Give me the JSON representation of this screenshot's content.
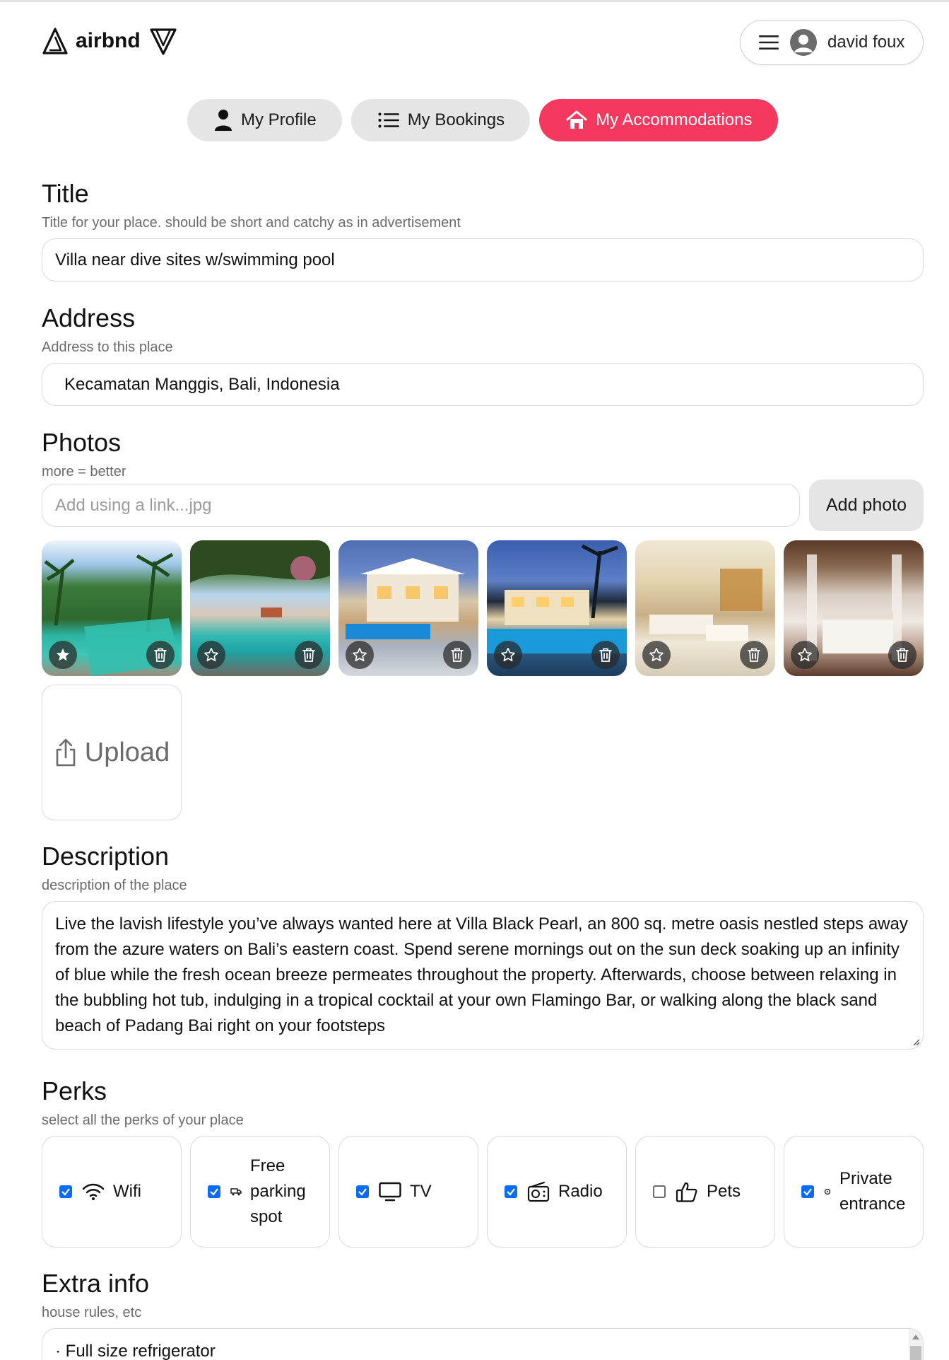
{
  "app": {
    "brand": "airbnd",
    "user_name": "david foux"
  },
  "nav": {
    "tabs": [
      {
        "label": "My Profile",
        "icon": "user-icon",
        "active": false
      },
      {
        "label": "My Bookings",
        "icon": "list-icon",
        "active": false
      },
      {
        "label": "My Accommodations",
        "icon": "home-icon",
        "active": true
      }
    ]
  },
  "form": {
    "title": {
      "heading": "Title",
      "hint": "Title for your place. should be short and catchy as in advertisement",
      "value": "Villa near dive sites w/swimming pool"
    },
    "address": {
      "heading": "Address",
      "hint": "Address to this place",
      "value": "Kecamatan Manggis, Bali, Indonesia"
    },
    "photos": {
      "heading": "Photos",
      "hint": "more = better",
      "link_placeholder": "Add using a link...jpg",
      "add_button": "Add photo",
      "upload_label": "Upload",
      "items": [
        {
          "name": "photo-1",
          "main": true
        },
        {
          "name": "photo-2",
          "main": false
        },
        {
          "name": "photo-3",
          "main": false
        },
        {
          "name": "photo-4",
          "main": false
        },
        {
          "name": "photo-5",
          "main": false
        },
        {
          "name": "photo-6",
          "main": false
        }
      ]
    },
    "description": {
      "heading": "Description",
      "hint": "description of the place",
      "value": "Live the lavish lifestyle you’ve always wanted here at Villa Black Pearl, an 800 sq. metre oasis nestled steps away from the azure waters on Bali’s eastern coast. Spend serene mornings out on the sun deck soaking up an infinity of blue while the fresh ocean breeze permeates throughout the property. Afterwards, choose between relaxing in the bubbling hot tub, indulging in a tropical cocktail at your own Flamingo Bar, or walking along the black sand beach of Padang Bai right on your footsteps"
    },
    "perks": {
      "heading": "Perks",
      "hint": "select all the perks of your place",
      "items": [
        {
          "label": "Wifi",
          "checked": true,
          "icon": "wifi-icon"
        },
        {
          "label": "Free parking spot",
          "checked": true,
          "icon": "truck-icon"
        },
        {
          "label": "TV",
          "checked": true,
          "icon": "tv-icon"
        },
        {
          "label": "Radio",
          "checked": true,
          "icon": "radio-icon"
        },
        {
          "label": "Pets",
          "checked": false,
          "icon": "thumbs-up-icon"
        },
        {
          "label": "Private entrance",
          "checked": true,
          "icon": "key-icon"
        }
      ]
    },
    "extra": {
      "heading": "Extra info",
      "hint": "house rules, etc",
      "value": "· Full size refrigerator"
    }
  },
  "colors": {
    "accent": "#f5385d",
    "tab_bg": "#e5e5e5",
    "checkbox": "#0a6cf1"
  }
}
